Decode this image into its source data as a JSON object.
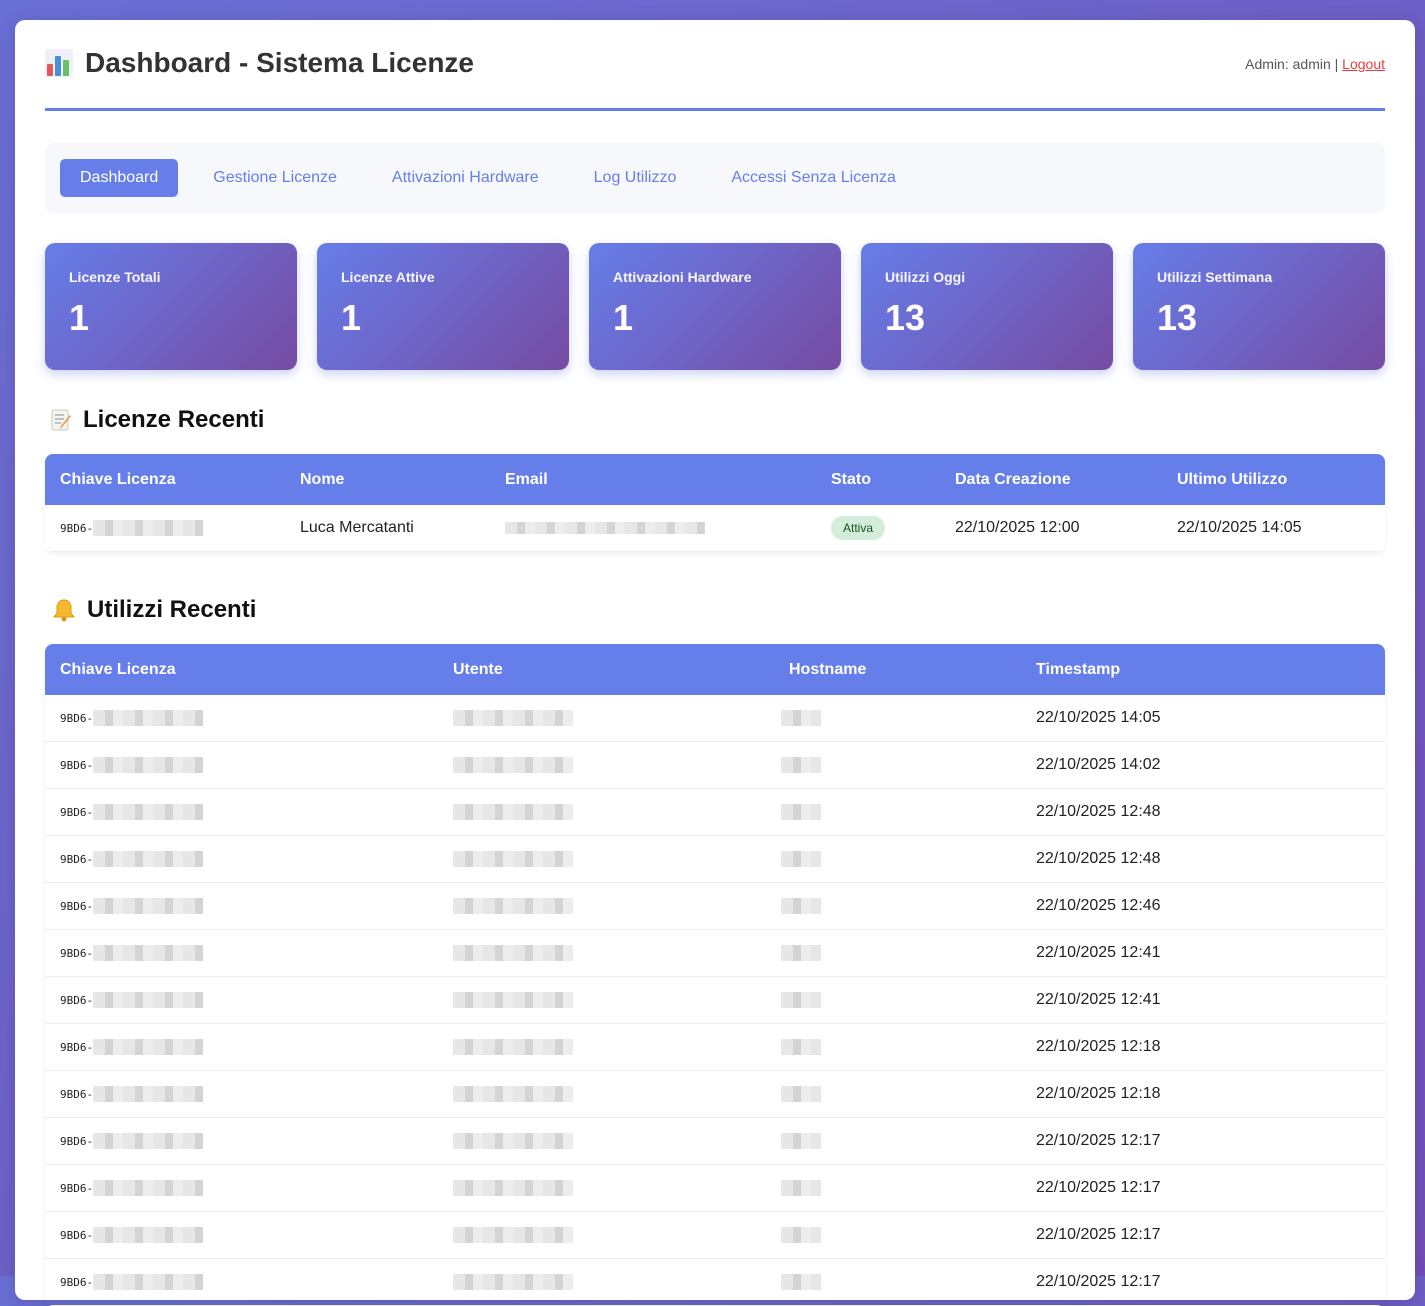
{
  "header": {
    "title": "Dashboard - Sistema Licenze",
    "admin_label": "Admin: admin |",
    "logout_label": "Logout"
  },
  "nav": [
    {
      "label": "Dashboard",
      "active": true
    },
    {
      "label": "Gestione Licenze",
      "active": false
    },
    {
      "label": "Attivazioni Hardware",
      "active": false
    },
    {
      "label": "Log Utilizzo",
      "active": false
    },
    {
      "label": "Accessi Senza Licenza",
      "active": false
    }
  ],
  "stats": [
    {
      "label": "Licenze Totali",
      "value": "1"
    },
    {
      "label": "Licenze Attive",
      "value": "1"
    },
    {
      "label": "Attivazioni Hardware",
      "value": "1"
    },
    {
      "label": "Utilizzi Oggi",
      "value": "13"
    },
    {
      "label": "Utilizzi Settimana",
      "value": "13"
    }
  ],
  "recent_licenses": {
    "title": "Licenze Recenti",
    "columns": [
      "Chiave Licenza",
      "Nome",
      "Email",
      "Stato",
      "Data Creazione",
      "Ultimo Utilizzo"
    ],
    "rows": [
      {
        "key_prefix": "9BD6-",
        "name": "Luca Mercatanti",
        "status": "Attiva",
        "created": "22/10/2025 12:00",
        "last_used": "22/10/2025 14:05"
      }
    ]
  },
  "recent_usage": {
    "title": "Utilizzi Recenti",
    "columns": [
      "Chiave Licenza",
      "Utente",
      "Hostname",
      "Timestamp"
    ],
    "rows": [
      {
        "key_prefix": "9BD6-",
        "timestamp": "22/10/2025 14:05"
      },
      {
        "key_prefix": "9BD6-",
        "timestamp": "22/10/2025 14:02"
      },
      {
        "key_prefix": "9BD6-",
        "timestamp": "22/10/2025 12:48"
      },
      {
        "key_prefix": "9BD6-",
        "timestamp": "22/10/2025 12:48"
      },
      {
        "key_prefix": "9BD6-",
        "timestamp": "22/10/2025 12:46"
      },
      {
        "key_prefix": "9BD6-",
        "timestamp": "22/10/2025 12:41"
      },
      {
        "key_prefix": "9BD6-",
        "timestamp": "22/10/2025 12:41"
      },
      {
        "key_prefix": "9BD6-",
        "timestamp": "22/10/2025 12:18"
      },
      {
        "key_prefix": "9BD6-",
        "timestamp": "22/10/2025 12:18"
      },
      {
        "key_prefix": "9BD6-",
        "timestamp": "22/10/2025 12:17"
      },
      {
        "key_prefix": "9BD6-",
        "timestamp": "22/10/2025 12:17"
      },
      {
        "key_prefix": "9BD6-",
        "timestamp": "22/10/2025 12:17"
      },
      {
        "key_prefix": "9BD6-",
        "timestamp": "22/10/2025 12:17"
      }
    ]
  },
  "colors": {
    "accent": "#667eea",
    "gradient_end": "#764ba2",
    "logout": "#e53e3e",
    "badge_bg": "#d4edda"
  }
}
